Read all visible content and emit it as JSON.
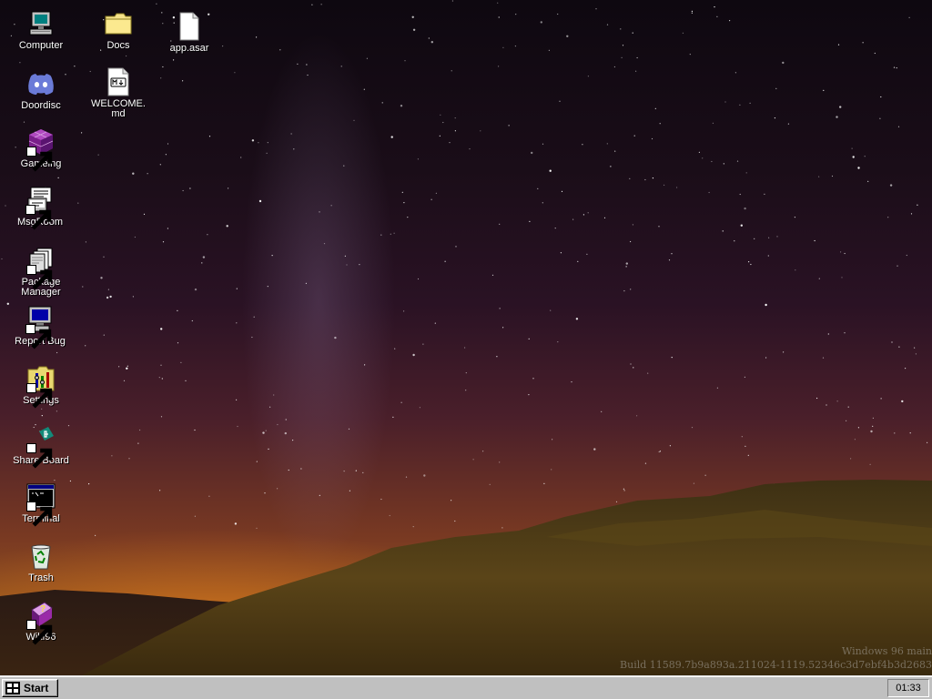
{
  "desktop": {
    "icons": [
      {
        "name": "computer-icon",
        "label": "Computer"
      },
      {
        "name": "folder-icon",
        "label": "Docs"
      },
      {
        "name": "file-icon",
        "label": "app.asar"
      },
      {
        "name": "discord-icon",
        "label": "Doordisc"
      },
      {
        "name": "markdown-file-icon",
        "label": "WELCOME.md"
      },
      {
        "name": "cube-icon",
        "label": "Gameing"
      },
      {
        "name": "chat-icon",
        "label": "MsgRoom"
      },
      {
        "name": "package-icon",
        "label": "Package Manager"
      },
      {
        "name": "monitor-icon",
        "label": "Report Bug"
      },
      {
        "name": "control-panel-icon",
        "label": "Settings"
      },
      {
        "name": "share-icon",
        "label": "Share Board"
      },
      {
        "name": "terminal-icon",
        "label": "Terminal"
      },
      {
        "name": "recycle-bin-icon",
        "label": "Trash"
      },
      {
        "name": "help-book-icon",
        "label": "Wiki96"
      }
    ],
    "watermark": {
      "line1": "Windows 96 main",
      "line2": "Build 11589.7b9a893a.211024-1119.52346c3d7ebf4b3d2683"
    }
  },
  "taskbar": {
    "start_label": "Start",
    "clock": "01:33"
  }
}
